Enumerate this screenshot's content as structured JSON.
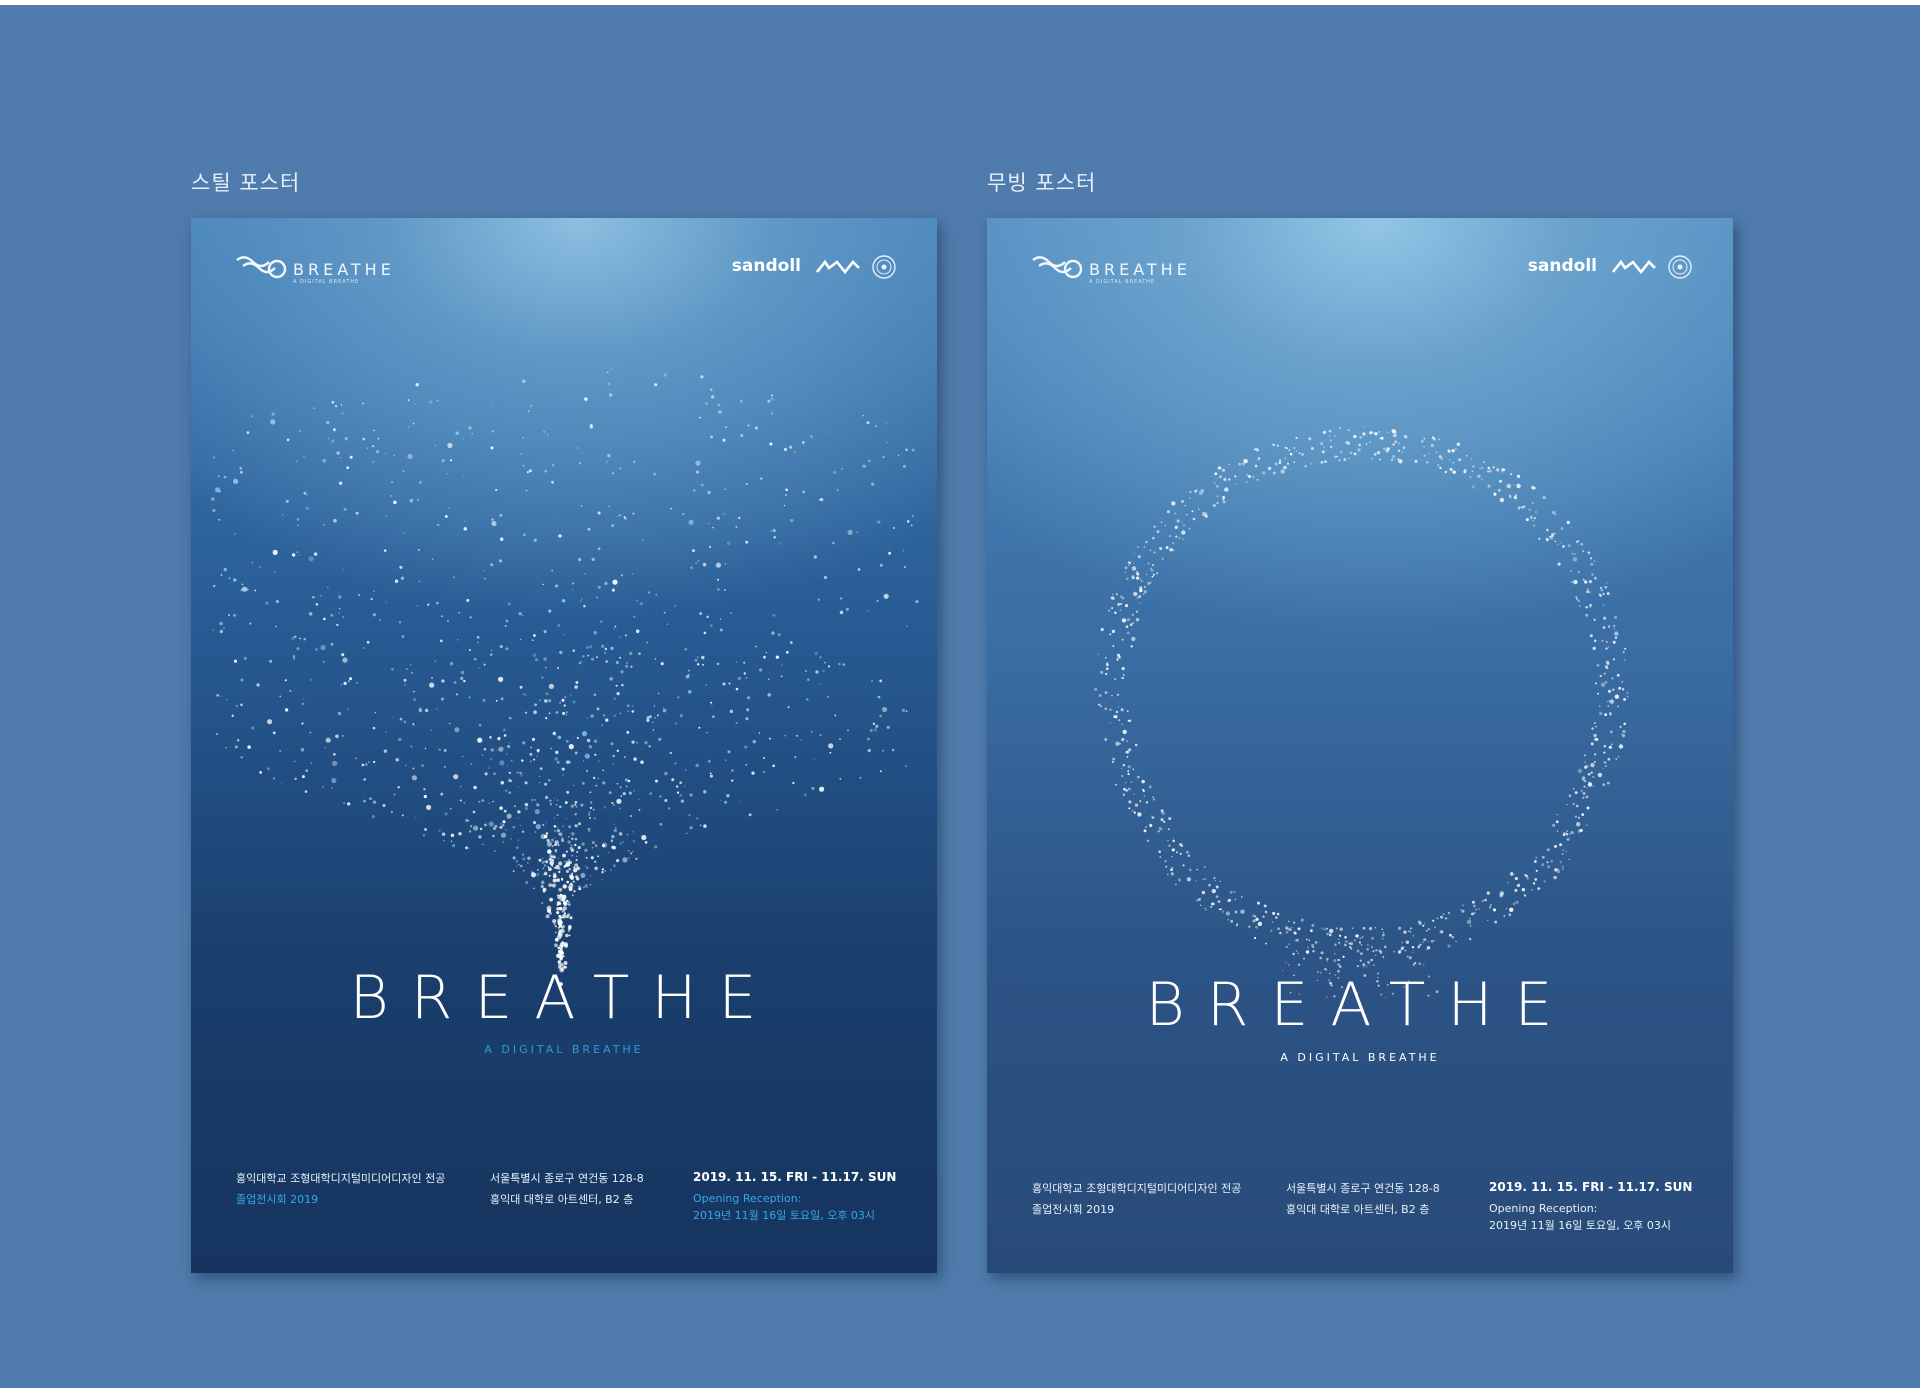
{
  "labels": {
    "still": "스틸 포스터",
    "moving": "무빙 포스터"
  },
  "posters": {
    "still": {
      "logo_word": "BREATHE",
      "logo_sub": "A DIGITAL BREATHE",
      "sponsor": "sandoll",
      "title": "BREATHE",
      "subtitle": "A DIGITAL BREATHE",
      "org_line1": "홍익대학교 조형대학디지털미디어디자인 전공",
      "org_line2": "졸업전시회 2019",
      "addr_line1": "서울특별시 종로구 연건동 128-8",
      "addr_line2": "홍익대 대학로 아트센터,  B2 층",
      "date": "2019. 11. 15. FRI - 11.17. SUN",
      "reception_label": "Opening Reception:",
      "reception_time": "2019년 11월 16일 토요일, 오후 03시"
    },
    "moving": {
      "logo_word": "BREATHE",
      "logo_sub": "A DIGITAL BREATHE",
      "sponsor": "sandoll",
      "title": "BREATHE",
      "subtitle": "A DIGITAL BREATHE",
      "org_line1": "홍익대학교 조형대학디지털미디어디자인 전공",
      "org_line2": "졸업전시회 2019",
      "addr_line1": "서울특별시 종로구 연건동 128-8",
      "addr_line2": "홍익대 대학로 아트센터,  B2 층",
      "date": "2019. 11. 15. FRI - 11.17. SUN",
      "reception_label": "Opening Reception:",
      "reception_time": "2019년 11월 16일 토요일, 오후 03시"
    }
  },
  "colors": {
    "page_background": "#507cad",
    "highlight": "#34a8e6",
    "particle": "#ffffff"
  },
  "icons": {
    "logo": "breathe-swirl-icon",
    "sponsor_mark": "wave-mark-icon",
    "seal": "university-seal-icon"
  }
}
